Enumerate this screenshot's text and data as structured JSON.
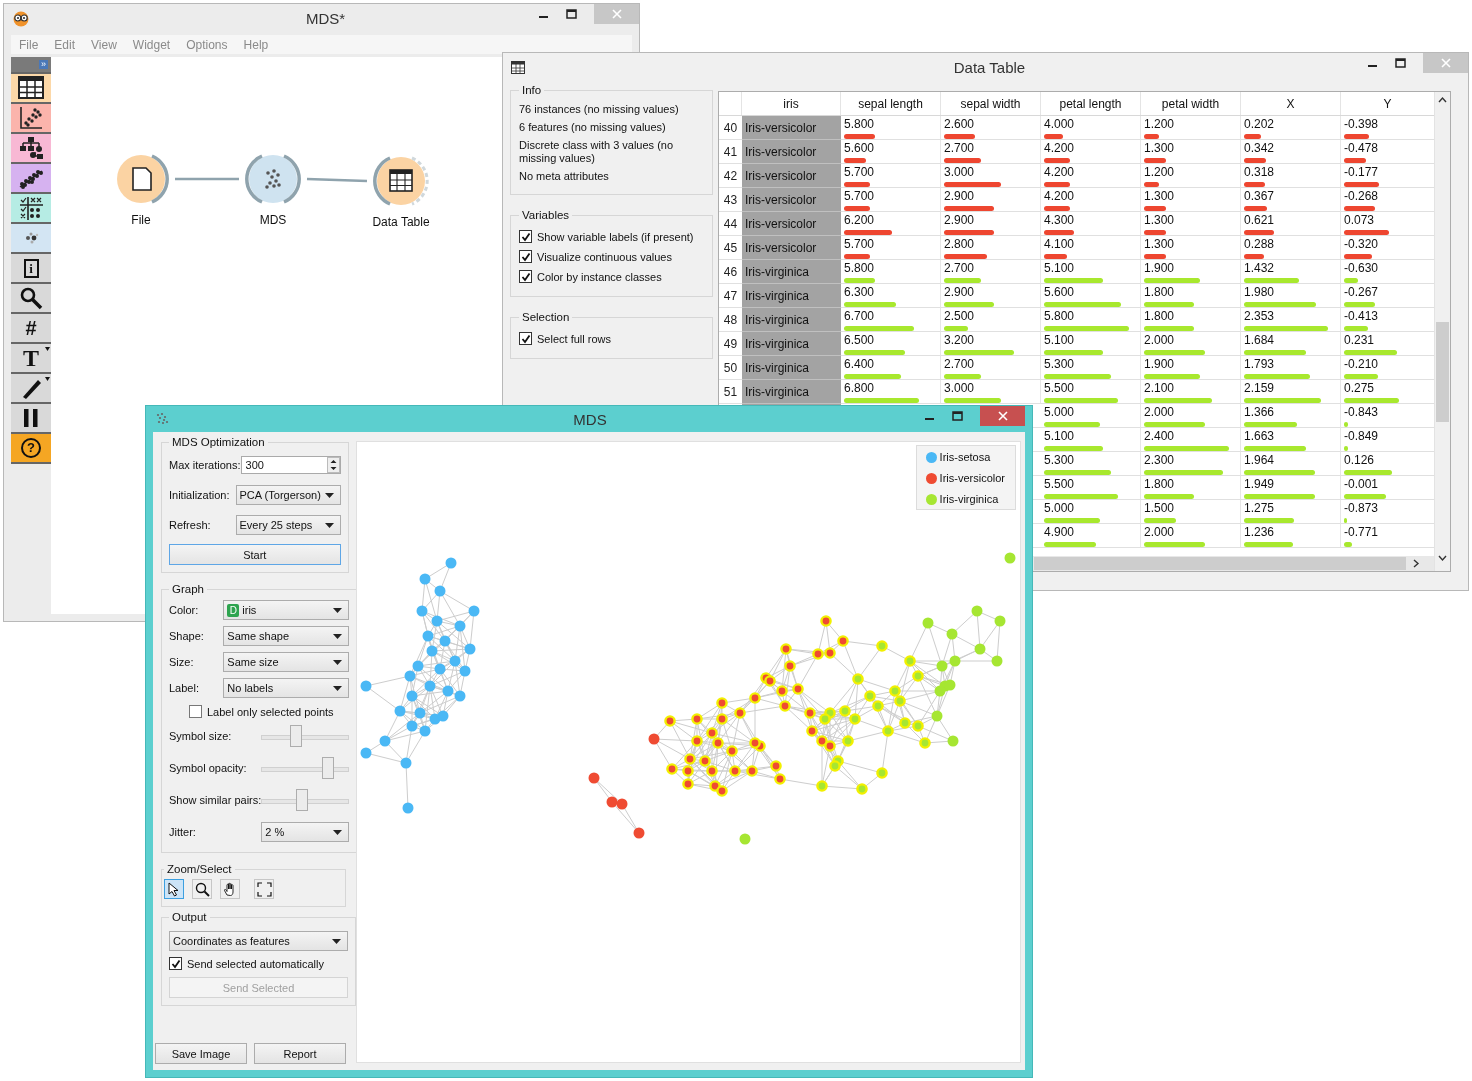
{
  "canvas_window": {
    "title": "MDS*",
    "active": false,
    "menu": [
      "File",
      "Edit",
      "View",
      "Widget",
      "Options",
      "Help"
    ],
    "toolbox_toggle": "»",
    "toolbox": [
      {
        "kind": "table",
        "color": "#fcd8a8"
      },
      {
        "kind": "scatter",
        "color": "#fbb4ac"
      },
      {
        "kind": "tree",
        "color": "#f8b8d4"
      },
      {
        "kind": "regression",
        "color": "#d6b2f0"
      },
      {
        "kind": "grid",
        "color": "#b6ece4"
      },
      {
        "kind": "points",
        "color": "#d3e5f3"
      },
      {
        "kind": "info",
        "glyph": "i"
      },
      {
        "kind": "search"
      },
      {
        "kind": "hash",
        "glyph": "#"
      },
      {
        "kind": "text",
        "glyph": "T",
        "menu": true
      },
      {
        "kind": "pen",
        "menu": true
      },
      {
        "kind": "pause"
      },
      {
        "kind": "help",
        "glyph": "?",
        "color": "#f5a623"
      }
    ],
    "nodes": [
      {
        "label": "File",
        "kind": "file",
        "color": "#fbd3a3"
      },
      {
        "label": "MDS",
        "kind": "mds",
        "color": "#cfe3f0"
      },
      {
        "label": "Data Table",
        "kind": "table",
        "color": "#fbd3a3"
      }
    ]
  },
  "table_window": {
    "title": "Data Table",
    "active": false,
    "info": {
      "title": "Info",
      "lines": [
        "76 instances (no missing values)",
        "6 features (no missing values)",
        "Discrete class with 3 values (no missing values)",
        "No meta attributes"
      ]
    },
    "groups": [
      {
        "title": "Variables",
        "options": [
          {
            "label": "Show variable labels (if present)",
            "checked": true
          },
          {
            "label": "Visualize continuous values",
            "checked": true
          },
          {
            "label": "Color by instance classes",
            "checked": true
          }
        ]
      },
      {
        "title": "Selection",
        "options": [
          {
            "label": "Select full rows",
            "checked": true
          }
        ]
      }
    ],
    "columns": [
      "iris",
      "sepal length",
      "sepal width",
      "petal length",
      "petal width",
      "X",
      "Y"
    ],
    "rows": [
      {
        "index": "40",
        "class": "Iris-versicolor",
        "color": "#ee4630",
        "cells": [
          {
            "value": "5.800",
            "level": 0.34
          },
          {
            "value": "2.600",
            "level": 0.34
          },
          {
            "value": "4.000",
            "level": 0.21
          },
          {
            "value": "1.200",
            "level": 0.17
          },
          {
            "value": "0.202",
            "level": 0.19
          },
          {
            "value": "-0.398",
            "level": 0.3
          }
        ]
      },
      {
        "index": "41",
        "class": "Iris-versicolor",
        "color": "#ee4630",
        "cells": [
          {
            "value": "5.600",
            "level": 0.24
          },
          {
            "value": "2.700",
            "level": 0.41
          },
          {
            "value": "4.200",
            "level": 0.29
          },
          {
            "value": "1.300",
            "level": 0.24
          },
          {
            "value": "0.342",
            "level": 0.24
          },
          {
            "value": "-0.478",
            "level": 0.26
          }
        ]
      },
      {
        "index": "42",
        "class": "Iris-versicolor",
        "color": "#ee4630",
        "cells": [
          {
            "value": "5.700",
            "level": 0.29
          },
          {
            "value": "3.000",
            "level": 0.63
          },
          {
            "value": "4.200",
            "level": 0.29
          },
          {
            "value": "1.200",
            "level": 0.17
          },
          {
            "value": "0.318",
            "level": 0.23
          },
          {
            "value": "-0.177",
            "level": 0.42
          }
        ]
      },
      {
        "index": "43",
        "class": "Iris-versicolor",
        "color": "#ee4630",
        "cells": [
          {
            "value": "5.700",
            "level": 0.29
          },
          {
            "value": "2.900",
            "level": 0.55
          },
          {
            "value": "4.200",
            "level": 0.29
          },
          {
            "value": "1.300",
            "level": 0.24
          },
          {
            "value": "0.367",
            "level": 0.25
          },
          {
            "value": "-0.268",
            "level": 0.37
          }
        ]
      },
      {
        "index": "44",
        "class": "Iris-versicolor",
        "color": "#ee4630",
        "cells": [
          {
            "value": "6.200",
            "level": 0.53
          },
          {
            "value": "2.900",
            "level": 0.55
          },
          {
            "value": "4.300",
            "level": 0.33
          },
          {
            "value": "1.300",
            "level": 0.24
          },
          {
            "value": "0.621",
            "level": 0.33
          },
          {
            "value": "0.073",
            "level": 0.54
          }
        ]
      },
      {
        "index": "45",
        "class": "Iris-versicolor",
        "color": "#ee4630",
        "cells": [
          {
            "value": "5.700",
            "level": 0.29
          },
          {
            "value": "2.800",
            "level": 0.48
          },
          {
            "value": "4.100",
            "level": 0.25
          },
          {
            "value": "1.300",
            "level": 0.24
          },
          {
            "value": "0.288",
            "level": 0.22
          },
          {
            "value": "-0.320",
            "level": 0.33
          }
        ]
      },
      {
        "index": "46",
        "class": "Iris-virginica",
        "color": "#a8e82e",
        "cells": [
          {
            "value": "5.800",
            "level": 0.34
          },
          {
            "value": "2.700",
            "level": 0.41
          },
          {
            "value": "5.100",
            "level": 0.66
          },
          {
            "value": "1.900",
            "level": 0.62
          },
          {
            "value": "1.432",
            "level": 0.61
          },
          {
            "value": "-0.630",
            "level": 0.17
          }
        ]
      },
      {
        "index": "47",
        "class": "Iris-virginica",
        "color": "#a8e82e",
        "cells": [
          {
            "value": "6.300",
            "level": 0.58
          },
          {
            "value": "2.900",
            "level": 0.55
          },
          {
            "value": "5.600",
            "level": 0.86
          },
          {
            "value": "1.800",
            "level": 0.56
          },
          {
            "value": "1.980",
            "level": 0.8
          },
          {
            "value": "-0.267",
            "level": 0.37
          }
        ]
      },
      {
        "index": "48",
        "class": "Iris-virginica",
        "color": "#a8e82e",
        "cells": [
          {
            "value": "6.700",
            "level": 0.78
          },
          {
            "value": "2.500",
            "level": 0.27
          },
          {
            "value": "5.800",
            "level": 0.94
          },
          {
            "value": "1.800",
            "level": 0.56
          },
          {
            "value": "2.353",
            "level": 0.93
          },
          {
            "value": "-0.413",
            "level": 0.29
          }
        ]
      },
      {
        "index": "49",
        "class": "Iris-virginica",
        "color": "#a8e82e",
        "cells": [
          {
            "value": "6.500",
            "level": 0.68
          },
          {
            "value": "3.200",
            "level": 0.78
          },
          {
            "value": "5.100",
            "level": 0.66
          },
          {
            "value": "2.000",
            "level": 0.68
          },
          {
            "value": "1.684",
            "level": 0.69
          },
          {
            "value": "0.231",
            "level": 0.63
          }
        ]
      },
      {
        "index": "50",
        "class": "Iris-virginica",
        "color": "#a8e82e",
        "cells": [
          {
            "value": "6.400",
            "level": 0.63
          },
          {
            "value": "2.700",
            "level": 0.41
          },
          {
            "value": "5.300",
            "level": 0.74
          },
          {
            "value": "1.900",
            "level": 0.62
          },
          {
            "value": "1.793",
            "level": 0.73
          },
          {
            "value": "-0.210",
            "level": 0.4
          }
        ]
      },
      {
        "index": "51",
        "class": "Iris-virginica",
        "color": "#a8e82e",
        "cells": [
          {
            "value": "6.800",
            "level": 0.83
          },
          {
            "value": "3.000",
            "level": 0.63
          },
          {
            "value": "5.500",
            "level": 0.82
          },
          {
            "value": "2.100",
            "level": 0.75
          },
          {
            "value": "2.159",
            "level": 0.86
          },
          {
            "value": "0.275",
            "level": 0.65
          }
        ]
      },
      {
        "color": "#a8e82e",
        "cells": [
          {
            "value": "5.000",
            "level": 0.62
          },
          {
            "value": "2.000",
            "level": 0.68
          },
          {
            "value": "1.366",
            "level": 0.59
          },
          {
            "value": "-0.843",
            "level": 0.05
          }
        ]
      },
      {
        "color": "#a8e82e",
        "cells": [
          {
            "value": "5.100",
            "level": 0.66
          },
          {
            "value": "2.400",
            "level": 0.94
          },
          {
            "value": "1.663",
            "level": 0.69
          },
          {
            "value": "-0.849",
            "level": 0.05
          }
        ]
      },
      {
        "color": "#a8e82e",
        "cells": [
          {
            "value": "5.300",
            "level": 0.74
          },
          {
            "value": "2.300",
            "level": 0.88
          },
          {
            "value": "1.964",
            "level": 0.79
          },
          {
            "value": "0.126",
            "level": 0.57
          }
        ]
      },
      {
        "color": "#a8e82e",
        "cells": [
          {
            "value": "5.500",
            "level": 0.82
          },
          {
            "value": "1.800",
            "level": 0.56
          },
          {
            "value": "1.949",
            "level": 0.79
          },
          {
            "value": "-0.001",
            "level": 0.5
          }
        ]
      },
      {
        "color": "#a8e82e",
        "cells": [
          {
            "value": "5.000",
            "level": 0.62
          },
          {
            "value": "1.500",
            "level": 0.36
          },
          {
            "value": "1.275",
            "level": 0.56
          },
          {
            "value": "-0.873",
            "level": 0.04
          }
        ]
      },
      {
        "color": "#a8e82e",
        "cells": [
          {
            "value": "4.900",
            "level": 0.58
          },
          {
            "value": "2.000",
            "level": 0.68
          },
          {
            "value": "1.236",
            "level": 0.54
          },
          {
            "value": "-0.771",
            "level": 0.1
          }
        ]
      }
    ]
  },
  "mds_window": {
    "title": "MDS",
    "active": true,
    "optimization": {
      "title": "MDS Optimization",
      "max_iterations": {
        "label": "Max iterations:",
        "value": "300"
      },
      "initialization": {
        "label": "Initialization:",
        "value": "PCA (Torgerson)"
      },
      "refresh": {
        "label": "Refresh:",
        "value": "Every 25 steps"
      },
      "start": "Start"
    },
    "graph": {
      "title": "Graph",
      "dropdowns": [
        {
          "label": "Color:",
          "value": "iris",
          "badge": "D"
        },
        {
          "label": "Shape:",
          "value": "Same shape"
        },
        {
          "label": "Size:",
          "value": "Same size"
        },
        {
          "label": "Label:",
          "value": "No labels"
        }
      ],
      "label_only_selected": {
        "label": "Label only selected points",
        "checked": false
      },
      "sliders": [
        {
          "label": "Symbol size:",
          "level": 0.38
        },
        {
          "label": "Symbol opacity:",
          "level": 0.8
        },
        {
          "label": "Show similar pairs:",
          "level": 0.46
        }
      ],
      "jitter": {
        "label": "Jitter:",
        "value": "2 %"
      }
    },
    "zoom_select": {
      "title": "Zoom/Select",
      "tools": [
        {
          "kind": "pointer",
          "selected": true
        },
        {
          "kind": "zoom",
          "selected": false
        },
        {
          "kind": "pan",
          "selected": false
        },
        {
          "kind": "fit",
          "selected": false
        }
      ]
    },
    "output": {
      "title": "Output",
      "value": "Coordinates as features",
      "send_auto": {
        "label": "Send selected automatically",
        "checked": true
      },
      "send": {
        "label": "Send Selected",
        "disabled": true
      }
    },
    "buttons": [
      "Save Image",
      "Report"
    ],
    "legend": [
      {
        "label": "Iris-setosa",
        "color": "#4ab8f5"
      },
      {
        "label": "Iris-versicolor",
        "color": "#ef4b32"
      },
      {
        "label": "Iris-virginica",
        "color": "#a6e632"
      }
    ]
  }
}
